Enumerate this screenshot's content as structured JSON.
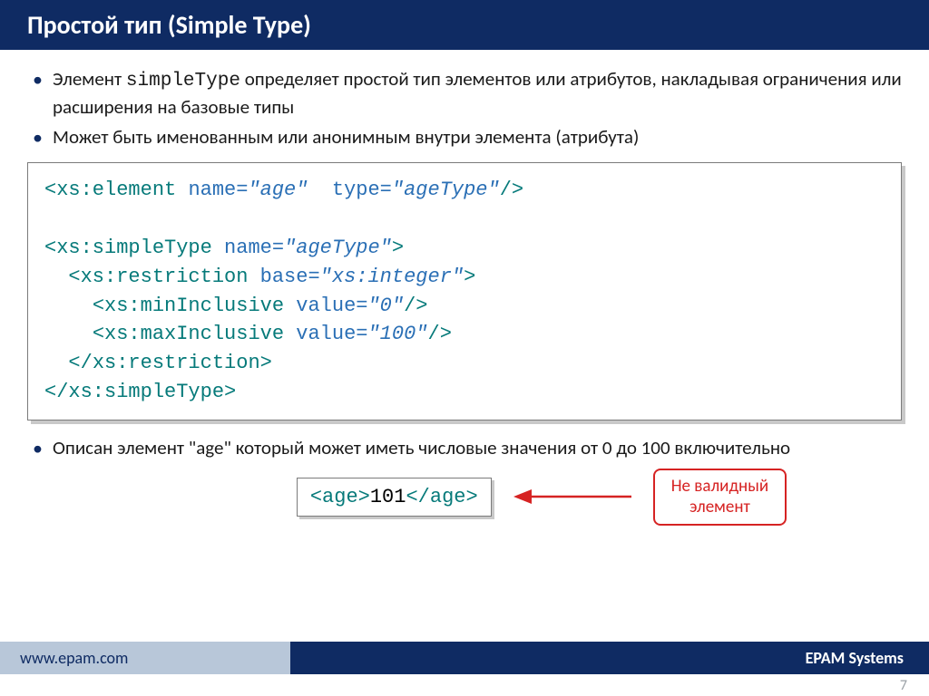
{
  "header": {
    "title": "Простой тип (Simple Type)"
  },
  "bullets": {
    "b1_prefix": "Элемент ",
    "b1_code": "simpleType",
    "b1_suffix": " определяет простой тип элементов или атрибутов, накладывая ограничения или расширения на базовые типы",
    "b2": "Может быть именованным или анонимным внутри элемента (атрибута)",
    "b3": "Описан элемент  \"age\"  который может иметь числовые значения от 0 до 100 включительно"
  },
  "code": {
    "l1": {
      "open": "<",
      "tag": "xs:element",
      "sp": " ",
      "a1n": "name=",
      "a1v": "\"age\"",
      "sp2": "  ",
      "a2n": "type=",
      "a2v": "\"ageType\"",
      "close": "/>"
    },
    "l3": {
      "open": "<",
      "tag": "xs:simpleType",
      "sp": " ",
      "a1n": "name=",
      "a1v": "\"ageType\"",
      "close": ">"
    },
    "l4": {
      "pad": "  ",
      "open": "<",
      "tag": "xs:restriction",
      "sp": " ",
      "a1n": "base=",
      "a1v": "\"xs:integer\"",
      "close": ">"
    },
    "l5": {
      "pad": "    ",
      "open": "<",
      "tag": "xs:minInclusive",
      "sp": " ",
      "a1n": "value=",
      "a1v": "\"0\"",
      "close": "/>"
    },
    "l6": {
      "pad": "    ",
      "open": "<",
      "tag": "xs:maxInclusive",
      "sp": " ",
      "a1n": "value=",
      "a1v": "\"100\"",
      "close": "/>"
    },
    "l7": {
      "pad": "  ",
      "open": "</",
      "tag": "xs:restriction",
      "close": ">"
    },
    "l8": {
      "open": "</",
      "tag": "xs:simpleType",
      "close": ">"
    }
  },
  "example": {
    "open": "<age>",
    "val": "101",
    "close": "</age>"
  },
  "callout": {
    "l1": "Не валидный",
    "l2": "элемент"
  },
  "footer": {
    "left": "www.epam.com",
    "right": "EPAM Systems"
  },
  "page": "7"
}
